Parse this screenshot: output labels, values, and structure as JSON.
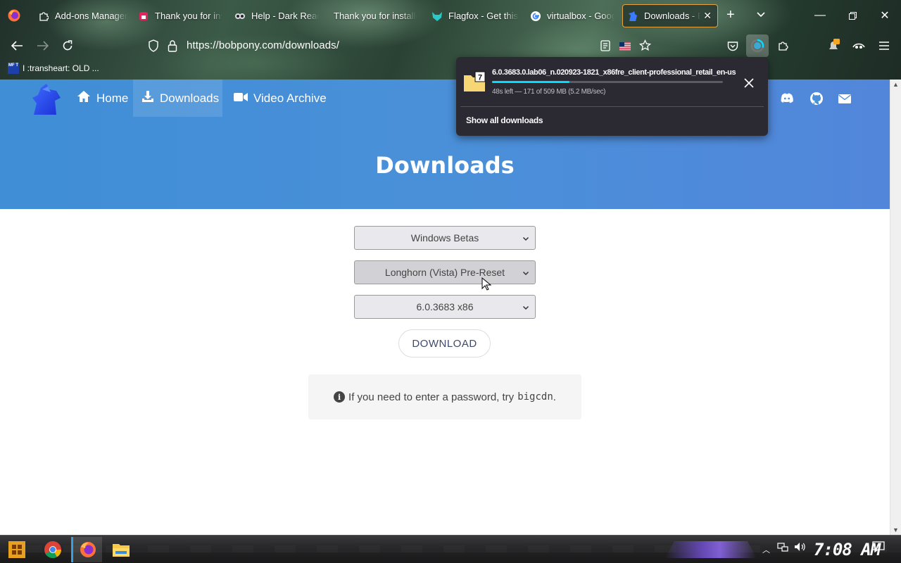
{
  "browser": {
    "tabs": [
      {
        "title": "Add-ons Manager",
        "icon": "puzzle-icon"
      },
      {
        "title": "Thank you for installing",
        "icon": "lock-icon"
      },
      {
        "title": "Help - Dark Reader",
        "icon": "dark-reader-icon"
      },
      {
        "title": "Thank you for installing",
        "icon": "none"
      },
      {
        "title": "Flagfox - Get this Extension",
        "icon": "fox-icon"
      },
      {
        "title": "virtualbox - Google Search",
        "icon": "google-icon"
      },
      {
        "title": "Downloads - BobPony",
        "icon": "bobpony-icon"
      }
    ],
    "url": "https://bobpony.com/downloads/",
    "bookmark": {
      "badge": "MF T",
      "label": "I :transheart: OLD ..."
    }
  },
  "downloads_panel": {
    "filename": "6.0.3683.0.lab06_n.020923-1821_x86fre_client-professional_retail_en-us",
    "status": "48s left — 171 of 509 MB (5.2 MB/sec)",
    "progress": 0.336,
    "show_all_label": "Show all downloads",
    "icon_badge": "7"
  },
  "site": {
    "nav": [
      {
        "label": "Home",
        "icon": "home-icon"
      },
      {
        "label": "Downloads",
        "icon": "download-icon"
      },
      {
        "label": "Video Archive",
        "icon": "video-camera-icon"
      }
    ],
    "heading": "Downloads",
    "selects": [
      {
        "value": "Windows Betas"
      },
      {
        "value": "Longhorn (Vista) Pre-Reset"
      },
      {
        "value": "6.0.3683 x86"
      }
    ],
    "download_button": "DOWNLOAD",
    "note": {
      "text": "If you need to enter a password, try",
      "code": "bigcdn",
      "suffix": "."
    }
  },
  "taskbar": {
    "clock": "7:08 AM"
  },
  "colors": {
    "hero": "#4a90d9",
    "download_progress": "#00ddff",
    "active_tab_border": "#e8a33c"
  }
}
